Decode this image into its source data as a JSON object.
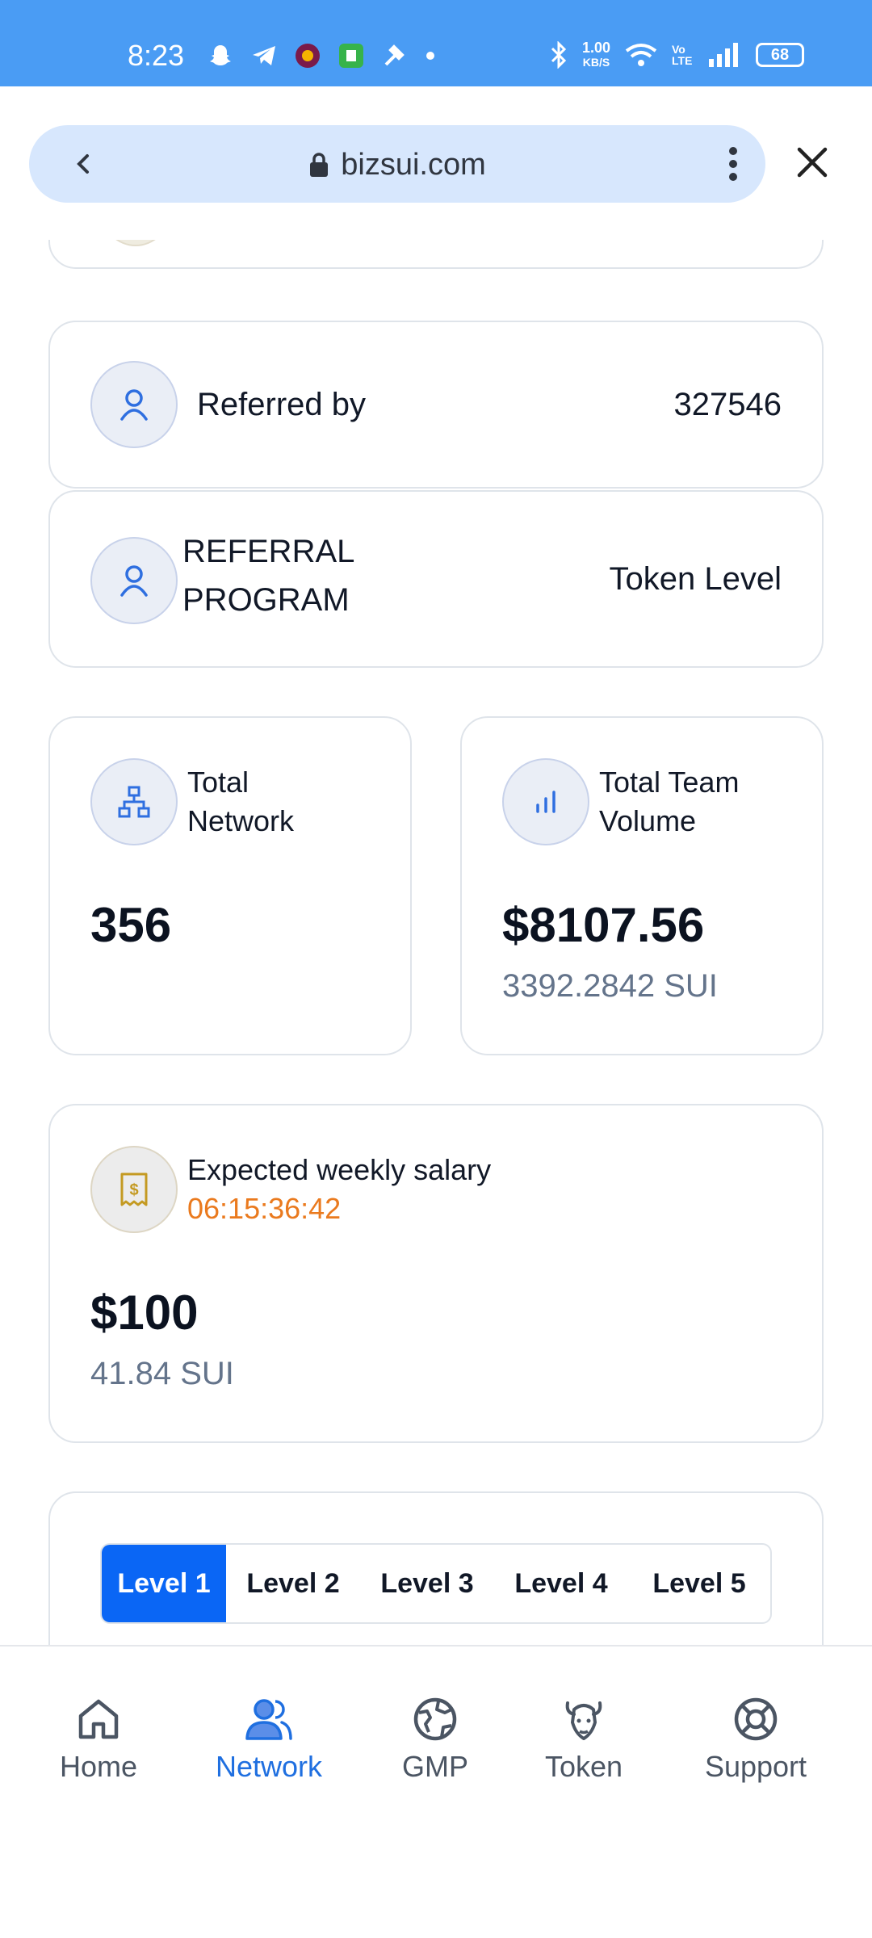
{
  "status_bar": {
    "time": "8:23",
    "net_speed_value": "1.00",
    "net_speed_unit": "KB/S",
    "volte": "Vo LTE",
    "battery": "68"
  },
  "browser": {
    "url": "bizsui.com"
  },
  "referred_by": {
    "label": "Referred by",
    "value": "327546"
  },
  "referral_program": {
    "label_line1": "REFERRAL",
    "label_line2": "PROGRAM",
    "value": "Token Level"
  },
  "total_network": {
    "label_line1": "Total",
    "label_line2": "Network",
    "value": "356"
  },
  "total_team_volume": {
    "label_line1": "Total Team",
    "label_line2": "Volume",
    "value": "$8107.56",
    "sub": "3392.2842 SUI"
  },
  "weekly_salary": {
    "label": "Expected weekly salary",
    "timer": "06:15:36:42",
    "value": "$100",
    "sub": "41.84 SUI"
  },
  "levels": {
    "tabs": [
      "Level 1",
      "Level 2",
      "Level 3",
      "Level 4",
      "Level 5"
    ],
    "active_index": 0
  },
  "nav": {
    "items": [
      {
        "label": "Home",
        "icon": "home-icon"
      },
      {
        "label": "Network",
        "icon": "users-icon"
      },
      {
        "label": "GMP",
        "icon": "globe-icon"
      },
      {
        "label": "Token",
        "icon": "bison-icon"
      },
      {
        "label": "Support",
        "icon": "lifebuoy-icon"
      }
    ],
    "active": "Network"
  },
  "colors": {
    "status_bar": "#4a9cf4",
    "accent": "#0a66f5",
    "nav_active": "#1f6fe0",
    "timer": "#ea7a1e"
  }
}
